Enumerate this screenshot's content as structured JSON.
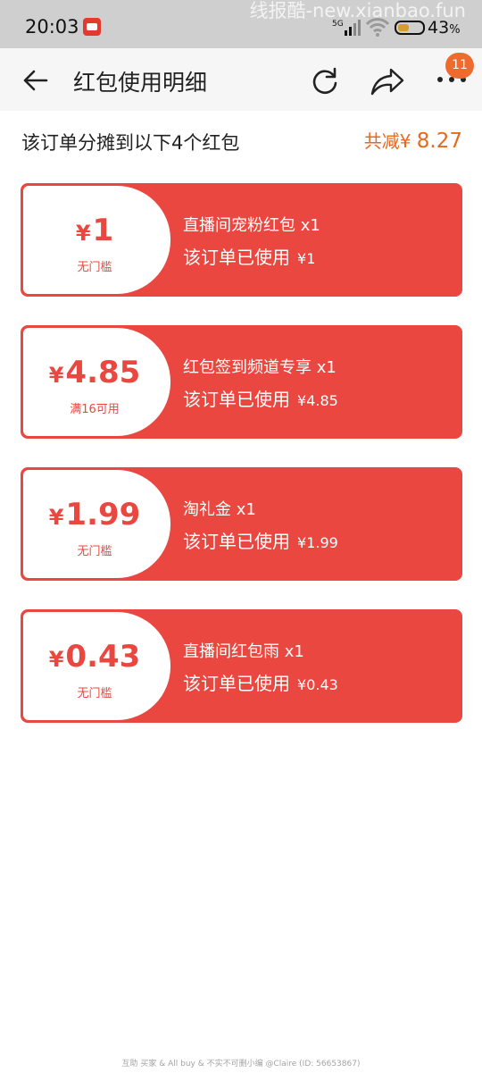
{
  "status_bar": {
    "time": "20:03",
    "network": "5G",
    "battery_percent": "43",
    "battery_unit": "%",
    "watermark": "线报酷-new.xianbao.fun"
  },
  "header": {
    "title": "红包使用明细",
    "notification_count": "11"
  },
  "summary": {
    "text": "该订单分摊到以下4个红包",
    "total_prefix": "共减¥",
    "total_amount": "8.27"
  },
  "coupons": [
    {
      "currency": "¥",
      "amount": "1",
      "condition": "无门槛",
      "name": "直播间宠粉红包 x1",
      "used_label": "该订单已使用",
      "used_currency": "¥",
      "used_amount": "1"
    },
    {
      "currency": "¥",
      "amount": "4.85",
      "condition": "满16可用",
      "name": "红包签到频道专享 x1",
      "used_label": "该订单已使用",
      "used_currency": "¥",
      "used_amount": "4.85"
    },
    {
      "currency": "¥",
      "amount": "1.99",
      "condition": "无门槛",
      "name": "淘礼金 x1",
      "used_label": "该订单已使用",
      "used_currency": "¥",
      "used_amount": "1.99"
    },
    {
      "currency": "¥",
      "amount": "0.43",
      "condition": "无门槛",
      "name": "直播间红包雨 x1",
      "used_label": "该订单已使用",
      "used_currency": "¥",
      "used_amount": "0.43"
    }
  ],
  "footer": {
    "watermark": "互助 买家 & All buy & 不实不可删小编 @Claire (ID: 56653867)"
  },
  "colors": {
    "accent_red": "#e9473f",
    "accent_orange": "#e8691c",
    "badge": "#ef6a2d"
  }
}
